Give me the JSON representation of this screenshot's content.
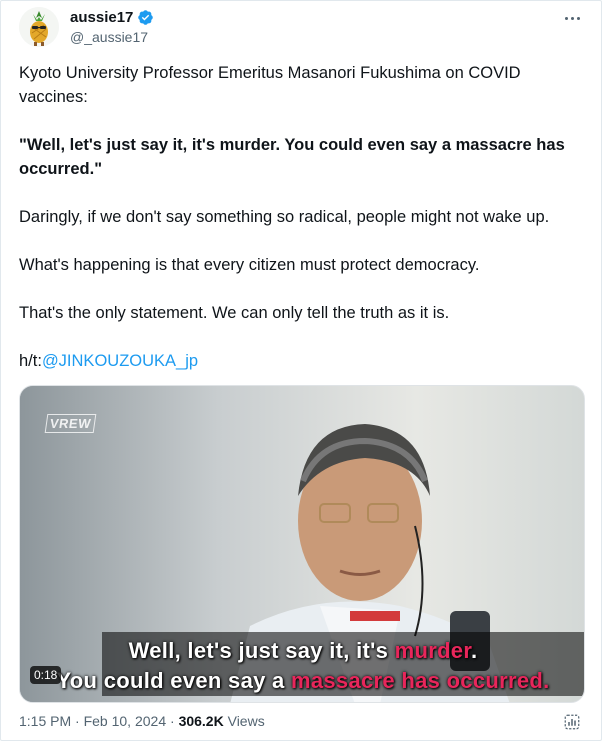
{
  "author": {
    "name": "aussie17",
    "handle": "@_aussie17",
    "verified": true
  },
  "tweet": {
    "line1": "Kyoto University Professor Emeritus Masanori Fukushima on COVID vaccines:",
    "quote": "\"Well, let's just say it, it's murder. You could even say a massacre has occurred.\"",
    "line3": "Daringly, if we don't say something so radical, people might not wake up.",
    "line4": "What's happening is that every citizen must protect democracy.",
    "line5": "That's the only statement. We can only tell the truth as it is.",
    "ht_prefix": "h/t:",
    "ht_link": "@JINKOUZOUKA_jp"
  },
  "video": {
    "watermark": "VREW",
    "subtitle1_a": "Well, let's just say it, it's ",
    "subtitle1_red": "murder",
    "subtitle1_b": ".",
    "subtitle2_a": "You could even say a ",
    "subtitle2_red": "massacre has occurred.",
    "duration": "0:18"
  },
  "meta": {
    "time": "1:15 PM",
    "sep1": " · ",
    "date": "Feb 10, 2024",
    "sep2": " · ",
    "views_count": "306.2K",
    "views_label": " Views"
  },
  "icons": {
    "more": "more-icon",
    "verified": "verified-badge-icon",
    "stats": "stats-icon"
  },
  "colors": {
    "link": "#1d9bf0",
    "verified": "#1d9bf0",
    "subtitle_accent": "#e8265b",
    "secondary_text": "#536471"
  }
}
